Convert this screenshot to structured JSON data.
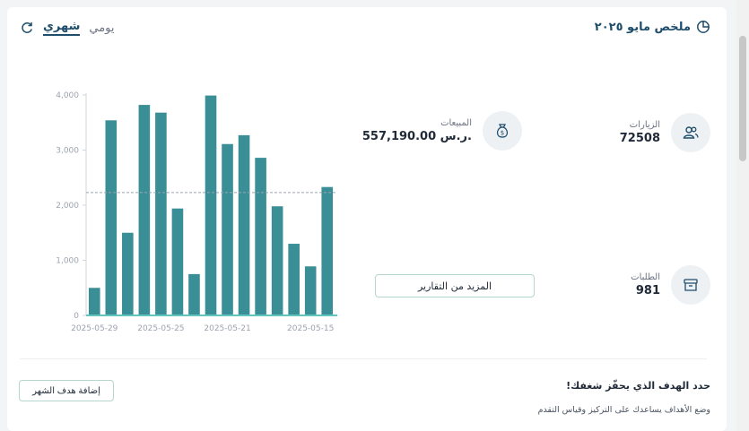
{
  "header": {
    "title": "ملخص مايو ٢٠٢٥",
    "tabs": {
      "monthly": "شهري",
      "daily": "يومي"
    }
  },
  "stats": {
    "visits": {
      "label": "الزيارات",
      "value": "72508"
    },
    "sales": {
      "label": "المبيعات",
      "value": "557,190.00 ر.س."
    },
    "orders": {
      "label": "الطلبات",
      "value": "981"
    }
  },
  "more_reports_label": "المزيد من التقارير",
  "goal": {
    "title": "حدد الهدف الذي يحفّز شغفك!",
    "subtitle": "وضع الأهداف يساعدك على التركيز وقياس التقدم",
    "button": "إضافة هدف الشهر"
  },
  "chart_data": {
    "type": "bar",
    "color": "#3a8e96",
    "average_line": 2230,
    "ylim": [
      0,
      4000
    ],
    "yticks": [
      "0",
      "1,000",
      "2,000",
      "3,000",
      "4,000"
    ],
    "xtick_labels": [
      "2025-05-29",
      "2025-05-25",
      "2025-05-21",
      "2025-05-15"
    ],
    "values": [
      500,
      3540,
      1500,
      3820,
      3680,
      1940,
      750,
      3990,
      3110,
      3270,
      2860,
      1980,
      1300,
      890,
      2330
    ]
  }
}
